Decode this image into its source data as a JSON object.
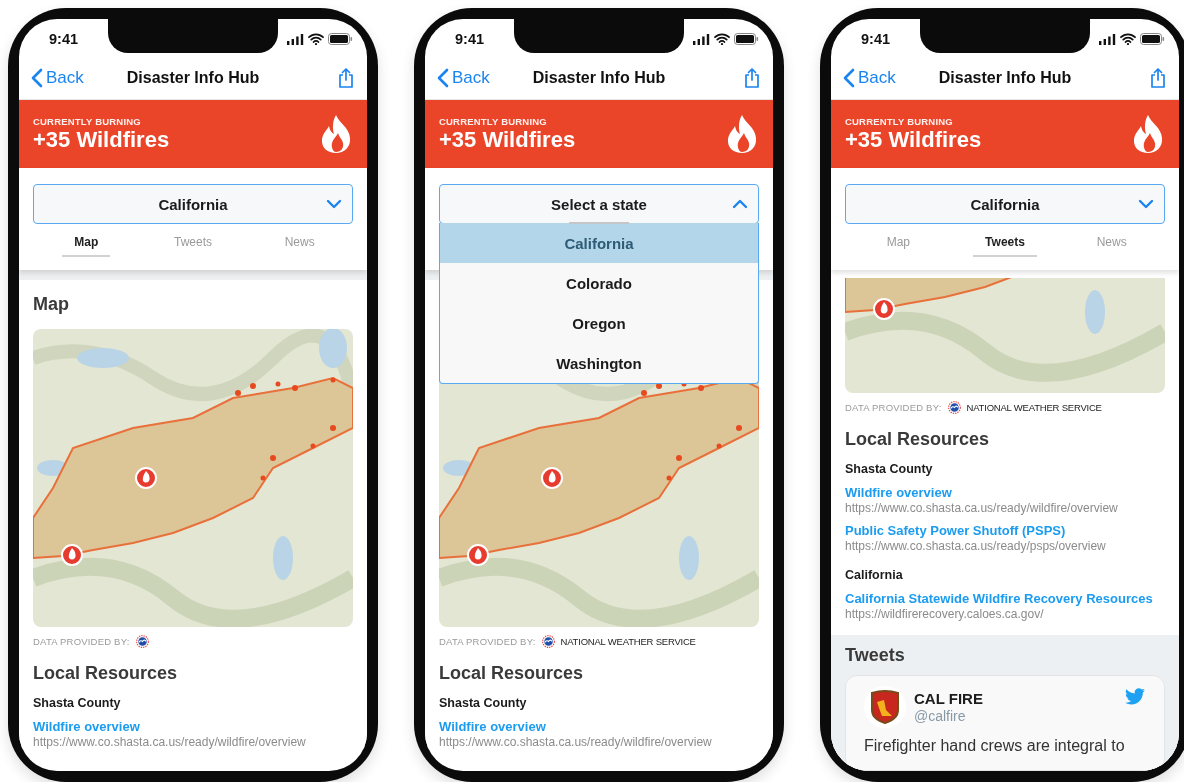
{
  "phones": [
    {
      "status": {
        "time": "9:41"
      },
      "nav": {
        "back": "Back",
        "title": "Disaster Info Hub"
      },
      "banner": {
        "label": "CURRENTLY BURNING",
        "headline": "+35 Wildfires"
      },
      "picker": {
        "value": "California",
        "expanded": false
      },
      "tabs": [
        {
          "label": "Map",
          "selected": true
        },
        {
          "label": "Tweets",
          "selected": false
        },
        {
          "label": "News",
          "selected": false
        }
      ],
      "content": [
        {
          "kind": "heading",
          "text": "Map"
        },
        {
          "kind": "map"
        },
        {
          "kind": "attribution",
          "label": "DATA PROVIDED BY:"
        },
        {
          "kind": "heading",
          "text": "Local Resources"
        },
        {
          "kind": "group",
          "text": "Shasta County"
        },
        {
          "kind": "link",
          "title": "Wildfire overview",
          "url": "https://www.co.shasta.ca.us/ready/wildfire/overview"
        }
      ]
    },
    {
      "status": {
        "time": "9:41"
      },
      "nav": {
        "back": "Back",
        "title": "Disaster Info Hub"
      },
      "banner": {
        "label": "CURRENTLY BURNING",
        "headline": "+35 Wildfires"
      },
      "picker": {
        "value": "Select a state",
        "expanded": true,
        "options": [
          {
            "label": "California",
            "selected": true
          },
          {
            "label": "Colorado",
            "selected": false
          },
          {
            "label": "Oregon",
            "selected": false
          },
          {
            "label": "Washington",
            "selected": false
          }
        ]
      },
      "content": [
        {
          "kind": "map"
        },
        {
          "kind": "attribution",
          "label": "DATA PROVIDED BY:",
          "source": "NATIONAL WEATHER SERVICE"
        },
        {
          "kind": "heading",
          "text": "Local Resources"
        },
        {
          "kind": "group",
          "text": "Shasta County"
        },
        {
          "kind": "link",
          "title": "Wildfire overview",
          "url": "https://www.co.shasta.ca.us/ready/wildfire/overview"
        }
      ]
    },
    {
      "status": {
        "time": "9:41"
      },
      "nav": {
        "back": "Back",
        "title": "Disaster Info Hub"
      },
      "banner": {
        "label": "CURRENTLY BURNING",
        "headline": "+35 Wildfires"
      },
      "picker": {
        "value": "California",
        "expanded": false
      },
      "tabs": [
        {
          "label": "Map",
          "selected": false
        },
        {
          "label": "Tweets",
          "selected": true
        },
        {
          "label": "News",
          "selected": false
        }
      ],
      "content": [
        {
          "kind": "map-partial"
        },
        {
          "kind": "attribution",
          "label": "DATA PROVIDED BY:",
          "source": "NATIONAL WEATHER SERVICE"
        },
        {
          "kind": "heading",
          "text": "Local Resources"
        },
        {
          "kind": "group",
          "text": "Shasta County"
        },
        {
          "kind": "link",
          "title": "Wildfire overview",
          "url": "https://www.co.shasta.ca.us/ready/wildfire/overview"
        },
        {
          "kind": "link",
          "title": "Public Safety Power Shutoff (PSPS)",
          "url": "https://www.co.shasta.ca.us/ready/psps/overview"
        },
        {
          "kind": "group",
          "text": "California"
        },
        {
          "kind": "link",
          "title": "California Statewide Wildfire Recovery Resources",
          "url": "https://wildfirerecovery.caloes.ca.gov/"
        },
        {
          "kind": "tweets",
          "title": "Tweets",
          "items": [
            {
              "name": "CAL FIRE",
              "handle": "@calfire",
              "text": "Firefighter hand crews are integral to"
            }
          ]
        }
      ]
    }
  ]
}
